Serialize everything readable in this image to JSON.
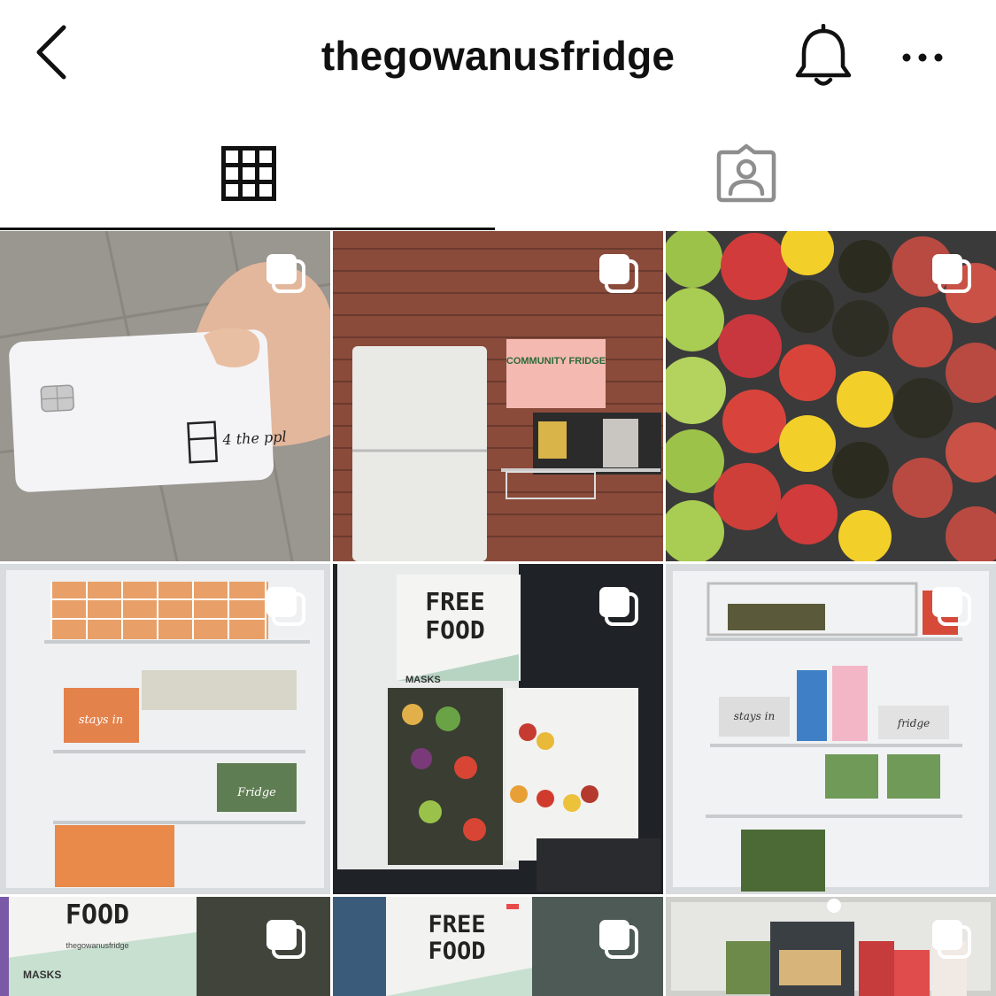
{
  "header": {
    "username": "thegowanusfridge",
    "back_icon": "chevron-left-icon",
    "bell_icon": "bell-icon",
    "more_icon": "more-horizontal-icon"
  },
  "tabs": [
    {
      "name": "posts-grid",
      "icon": "grid-icon",
      "active": true
    },
    {
      "name": "tagged",
      "icon": "tagged-person-icon",
      "active": false
    }
  ],
  "posts": [
    {
      "subject": "card",
      "multi": true
    },
    {
      "subject": "fridge-wall",
      "multi": true
    },
    {
      "subject": "fruit",
      "multi": true
    },
    {
      "subject": "fridge-carrots",
      "multi": true
    },
    {
      "subject": "fridge-open",
      "multi": true
    },
    {
      "subject": "fridge-shelves",
      "multi": true
    },
    {
      "subject": "food-sign",
      "multi": true
    },
    {
      "subject": "free-food-sign",
      "multi": true
    },
    {
      "subject": "fridge-inside",
      "multi": true
    }
  ],
  "photo_text": {
    "card_note": "4 the ppl",
    "community_sign": "COMMUNITY FRIDGE",
    "free": "FREE",
    "food": "FOOD",
    "masks": "MASKS",
    "handle": "thegowanusfridge",
    "stays": "stays in",
    "fridge_word": "fridge",
    "fridge_word_cap": "Fridge"
  },
  "colors": {
    "text": "#111111",
    "icon_gray": "#8e8e8e",
    "divider": "#111111"
  }
}
